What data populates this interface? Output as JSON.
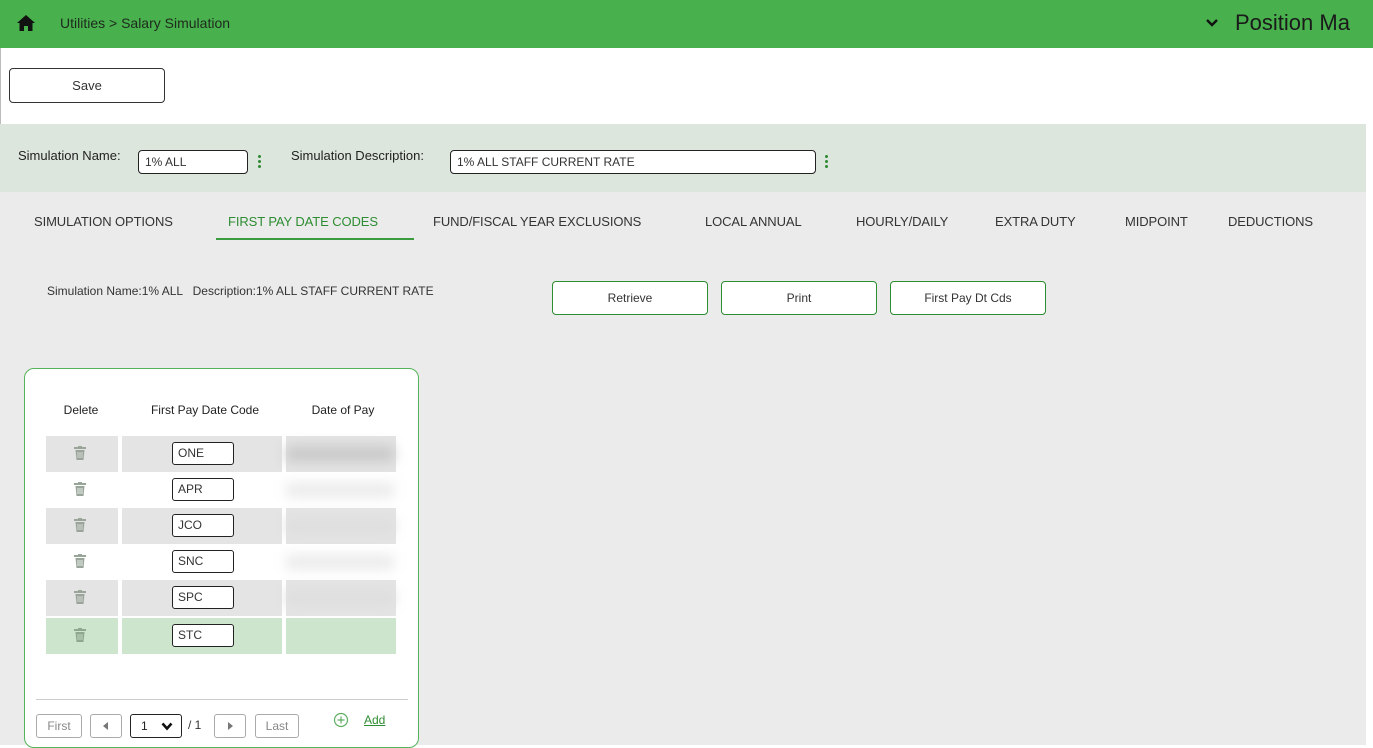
{
  "header": {
    "breadcrumb": "Utilities > Salary Simulation",
    "app_title": "Position Ma",
    "bar_color": "#48b04c"
  },
  "toolbar": {
    "save_label": "Save"
  },
  "simulation": {
    "name_label": "Simulation Name:",
    "name_value": "1% ALL",
    "desc_label": "Simulation Description:",
    "desc_value": "1% ALL STAFF CURRENT RATE"
  },
  "tabs": [
    {
      "label": "SIMULATION OPTIONS"
    },
    {
      "label": "FIRST PAY DATE CODES",
      "active": true
    },
    {
      "label": "FUND/FISCAL YEAR EXCLUSIONS"
    },
    {
      "label": "LOCAL ANNUAL"
    },
    {
      "label": "HOURLY/DAILY"
    },
    {
      "label": "EXTRA DUTY"
    },
    {
      "label": "MIDPOINT"
    },
    {
      "label": "DEDUCTIONS"
    }
  ],
  "info": {
    "text": "Simulation Name:1% ALL   Description:1% ALL STAFF CURRENT RATE",
    "retrieve_label": "Retrieve",
    "print_label": "Print",
    "first_pay_label": "First Pay Dt Cds"
  },
  "table": {
    "headers": [
      "Delete",
      "First Pay Date Code",
      "Date of Pay"
    ],
    "rows": [
      {
        "code": "ONE"
      },
      {
        "code": "APR"
      },
      {
        "code": "JCO"
      },
      {
        "code": "SNC"
      },
      {
        "code": "SPC"
      },
      {
        "code": "STC"
      }
    ]
  },
  "pager": {
    "first": "First",
    "last": "Last",
    "page": "1",
    "of": "/ 1",
    "add_label": "Add"
  }
}
